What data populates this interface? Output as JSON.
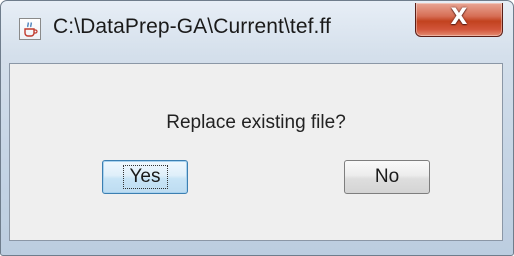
{
  "window": {
    "title": "C:\\DataPrep-GA\\Current\\tef.ff",
    "app_icon": "java-coffee-cup-icon",
    "close_glyph": "X"
  },
  "dialog": {
    "message": "Replace existing file?",
    "buttons": {
      "yes_label": "Yes",
      "no_label": "No"
    },
    "focused_button": "Yes"
  },
  "colors": {
    "close_button": "#c2421f",
    "focus_border": "#3c7fb1"
  }
}
